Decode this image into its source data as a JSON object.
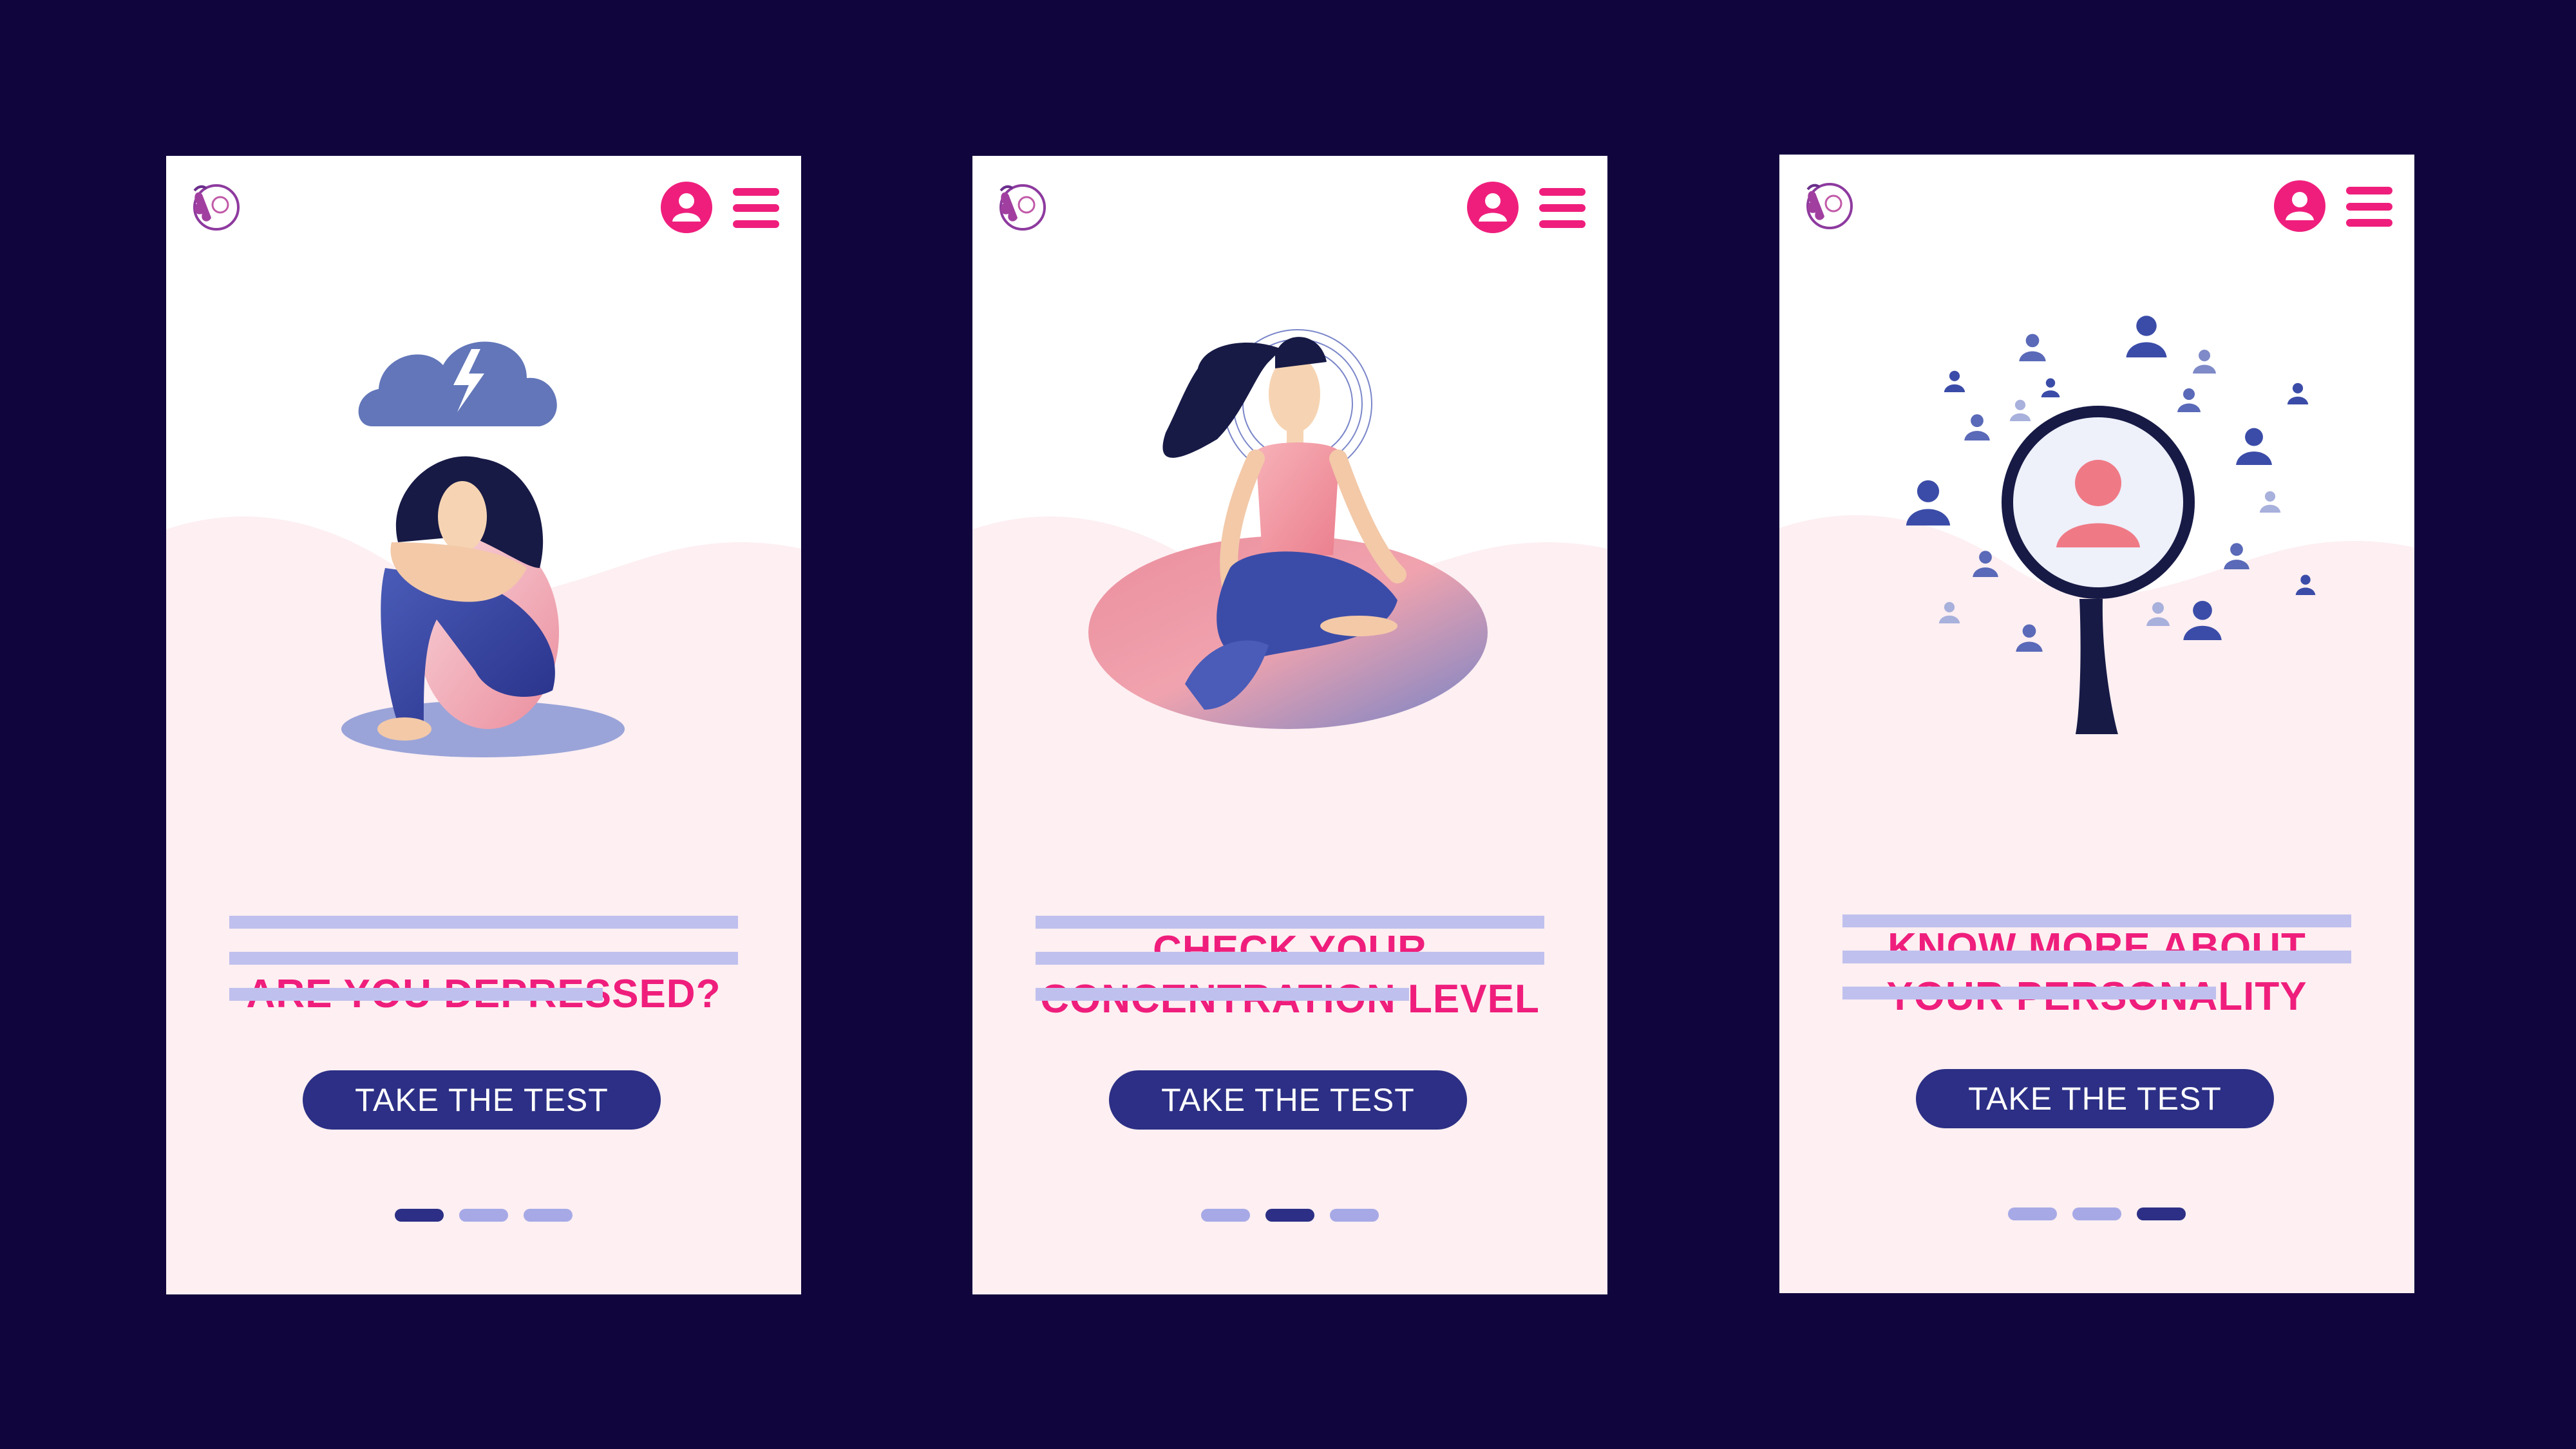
{
  "colors": {
    "background": "#11053d",
    "accent": "#ef1e7c",
    "button": "#2c2f85",
    "text_placeholder": "#bfc0ee",
    "dot_inactive": "#a7a9e6",
    "dot_active": "#2c2f85"
  },
  "icons": {
    "logo": "floral-face-logo",
    "profile": "user-circle-icon",
    "menu": "hamburger-menu-icon"
  },
  "screens": [
    {
      "title_lines": [
        "ARE YOU DEPRESSED?"
      ],
      "illustration": "sad-woman-under-storm-cloud",
      "cta_label": "TAKE THE TEST",
      "active_page": 1,
      "page_count": 3
    },
    {
      "title_lines": [
        "CHECK YOUR",
        "CONCENTRATION LEVEL"
      ],
      "illustration": "woman-meditating",
      "cta_label": "TAKE THE TEST",
      "active_page": 2,
      "page_count": 3
    },
    {
      "title_lines": [
        "KNOW MORE ABOUT",
        "YOUR PERSONALITY"
      ],
      "illustration": "magnifier-over-people",
      "cta_label": "TAKE THE TEST",
      "active_page": 3,
      "page_count": 3
    }
  ]
}
